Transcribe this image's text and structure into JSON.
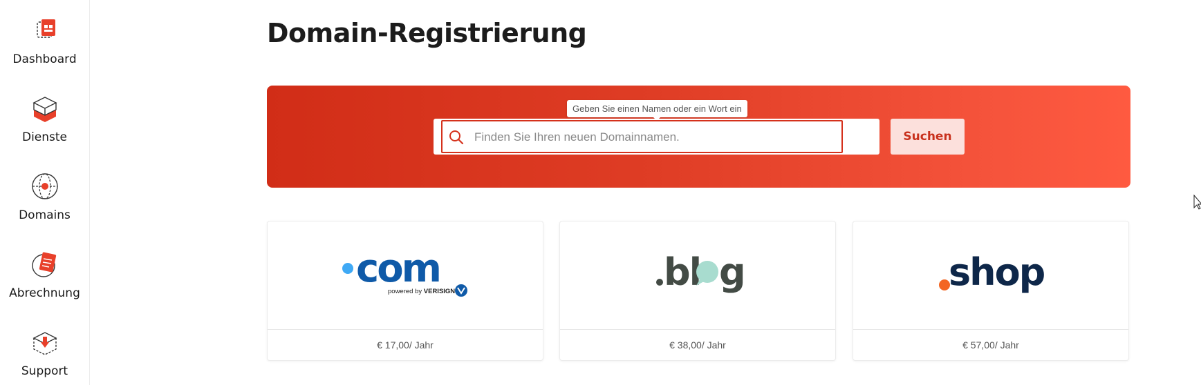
{
  "sidebar": {
    "items": [
      {
        "label": "Dashboard",
        "icon": "dashboard-icon"
      },
      {
        "label": "Dienste",
        "icon": "services-icon"
      },
      {
        "label": "Domains",
        "icon": "domains-icon"
      },
      {
        "label": "Abrechnung",
        "icon": "billing-icon"
      },
      {
        "label": "Support",
        "icon": "support-icon"
      }
    ]
  },
  "main": {
    "title": "Domain-Registrierung",
    "search": {
      "tooltip": "Geben Sie einen Namen oder ein Wort ein",
      "placeholder": "Finden Sie Ihren neuen Domainnamen.",
      "value": "",
      "button_label": "Suchen"
    },
    "tlds": [
      {
        "name": ".com",
        "brand_text": "powered by VERISIGN",
        "price": "€ 17,00/ Jahr"
      },
      {
        "name": ".blog",
        "price": "€ 38,00/ Jahr"
      },
      {
        "name": ".shop",
        "price": "€ 57,00/ Jahr"
      }
    ]
  },
  "colors": {
    "accent": "#d5311c",
    "hero_start": "#d12d17",
    "hero_end": "#ff5a40",
    "button_bg": "#fce0dc",
    "com_blue": "#0f5aa8",
    "com_dot": "#3fa9f5",
    "blog_gray": "#434b45",
    "blog_mint": "#a8dccf",
    "shop_navy": "#0e2749",
    "shop_orange": "#f36522"
  }
}
